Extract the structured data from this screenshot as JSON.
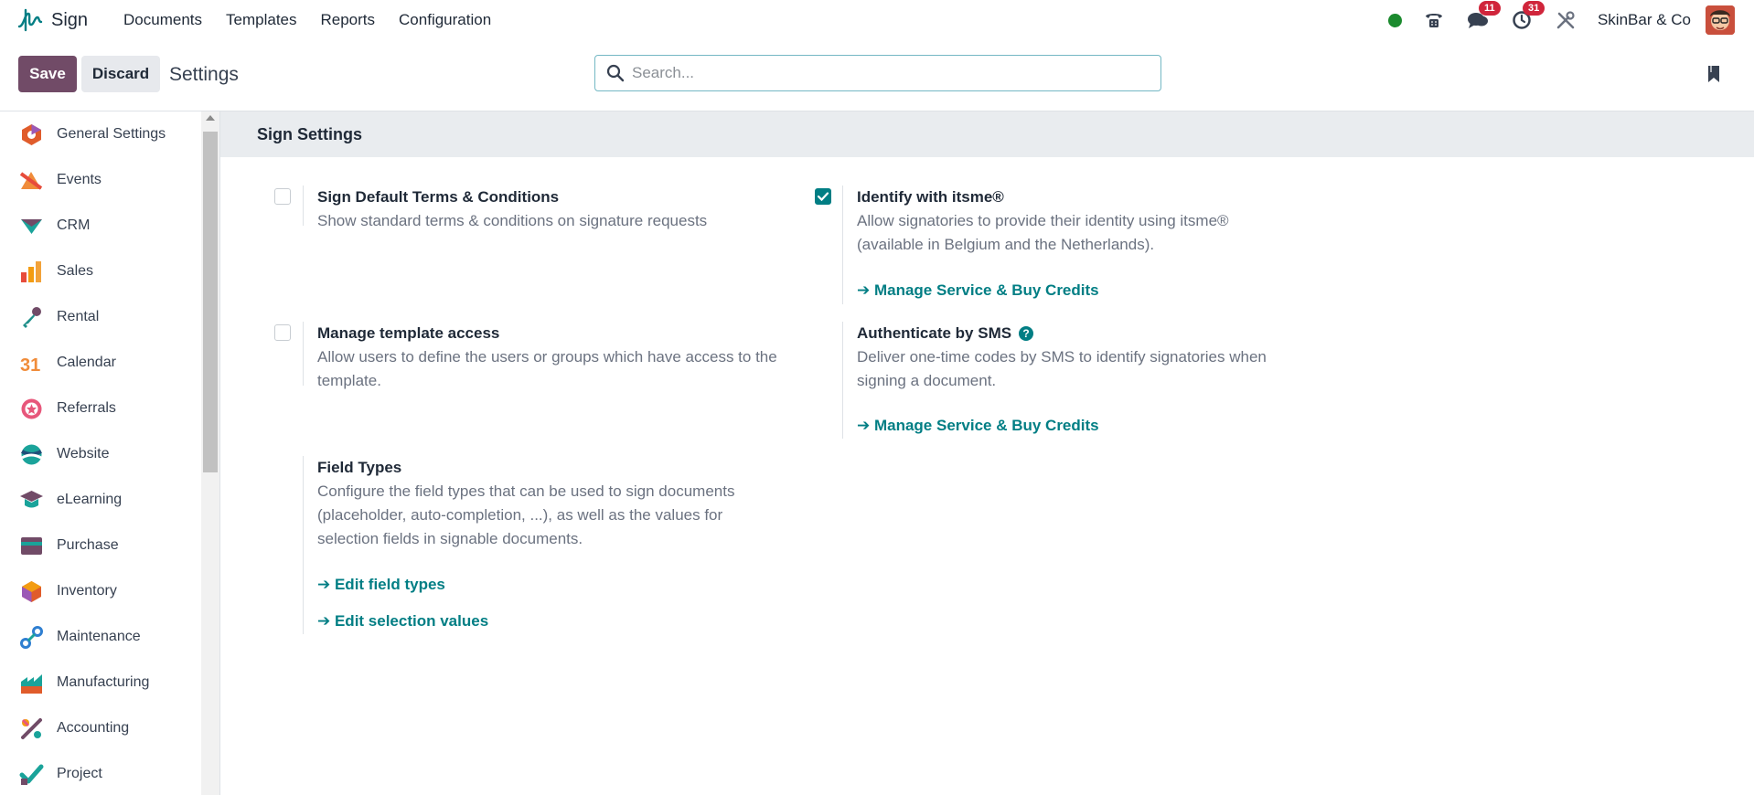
{
  "navbar": {
    "app_name": "Sign",
    "menu": [
      "Documents",
      "Templates",
      "Reports",
      "Configuration"
    ],
    "messages_count": "11",
    "activities_count": "31",
    "company": "SkinBar & Co"
  },
  "control_panel": {
    "save_label": "Save",
    "discard_label": "Discard",
    "title": "Settings",
    "search_placeholder": "Search..."
  },
  "sidebar": {
    "items": [
      {
        "label": "General Settings",
        "icon": "general-settings-icon",
        "color": "#e05c2b"
      },
      {
        "label": "Events",
        "icon": "events-icon",
        "color": "#f08c3a"
      },
      {
        "label": "CRM",
        "icon": "crm-icon",
        "color": "#1aa39a"
      },
      {
        "label": "Sales",
        "icon": "sales-icon",
        "color": "#f2a23a"
      },
      {
        "label": "Rental",
        "icon": "rental-icon",
        "color": "#1f8f8a"
      },
      {
        "label": "Calendar",
        "icon": "calendar-icon",
        "color": "#f08c3a"
      },
      {
        "label": "Referrals",
        "icon": "referrals-icon",
        "color": "#e7577b"
      },
      {
        "label": "Website",
        "icon": "website-icon",
        "color": "#1aa39a"
      },
      {
        "label": "eLearning",
        "icon": "elearning-icon",
        "color": "#1aa39a"
      },
      {
        "label": "Purchase",
        "icon": "purchase-icon",
        "color": "#714b67"
      },
      {
        "label": "Inventory",
        "icon": "inventory-icon",
        "color": "#e05c2b"
      },
      {
        "label": "Maintenance",
        "icon": "maintenance-icon",
        "color": "#2f7fd1"
      },
      {
        "label": "Manufacturing",
        "icon": "manufacturing-icon",
        "color": "#1aa39a"
      },
      {
        "label": "Accounting",
        "icon": "accounting-icon",
        "color": "#e7577b"
      },
      {
        "label": "Project",
        "icon": "project-icon",
        "color": "#1aa39a"
      }
    ]
  },
  "main": {
    "section_title": "Sign Settings",
    "settings": {
      "terms": {
        "title": "Sign Default Terms & Conditions",
        "desc": "Show standard terms & conditions on signature requests",
        "checked": false
      },
      "itsme": {
        "title": "Identify with itsme®",
        "desc": "Allow signatories to provide their identity using itsme® (available in Belgium and the Netherlands).",
        "link": "Manage Service & Buy Credits",
        "checked": true
      },
      "template_access": {
        "title": "Manage template access",
        "desc": "Allow users to define the users or groups which have access to the template.",
        "checked": false
      },
      "sms": {
        "title": "Authenticate by SMS",
        "desc": "Deliver one-time codes by SMS to identify signatories when signing a document.",
        "link": "Manage Service & Buy Credits"
      },
      "field_types": {
        "title": "Field Types",
        "desc": "Configure the field types that can be used to sign documents (placeholder, auto-completion, ...), as well as the values for selection fields in signable documents.",
        "link1": "Edit field types",
        "link2": "Edit selection values"
      }
    }
  },
  "colors": {
    "brand": "#714b67",
    "accent": "#017e84",
    "badge": "#d0253b",
    "status_online": "#1b8a2e"
  }
}
